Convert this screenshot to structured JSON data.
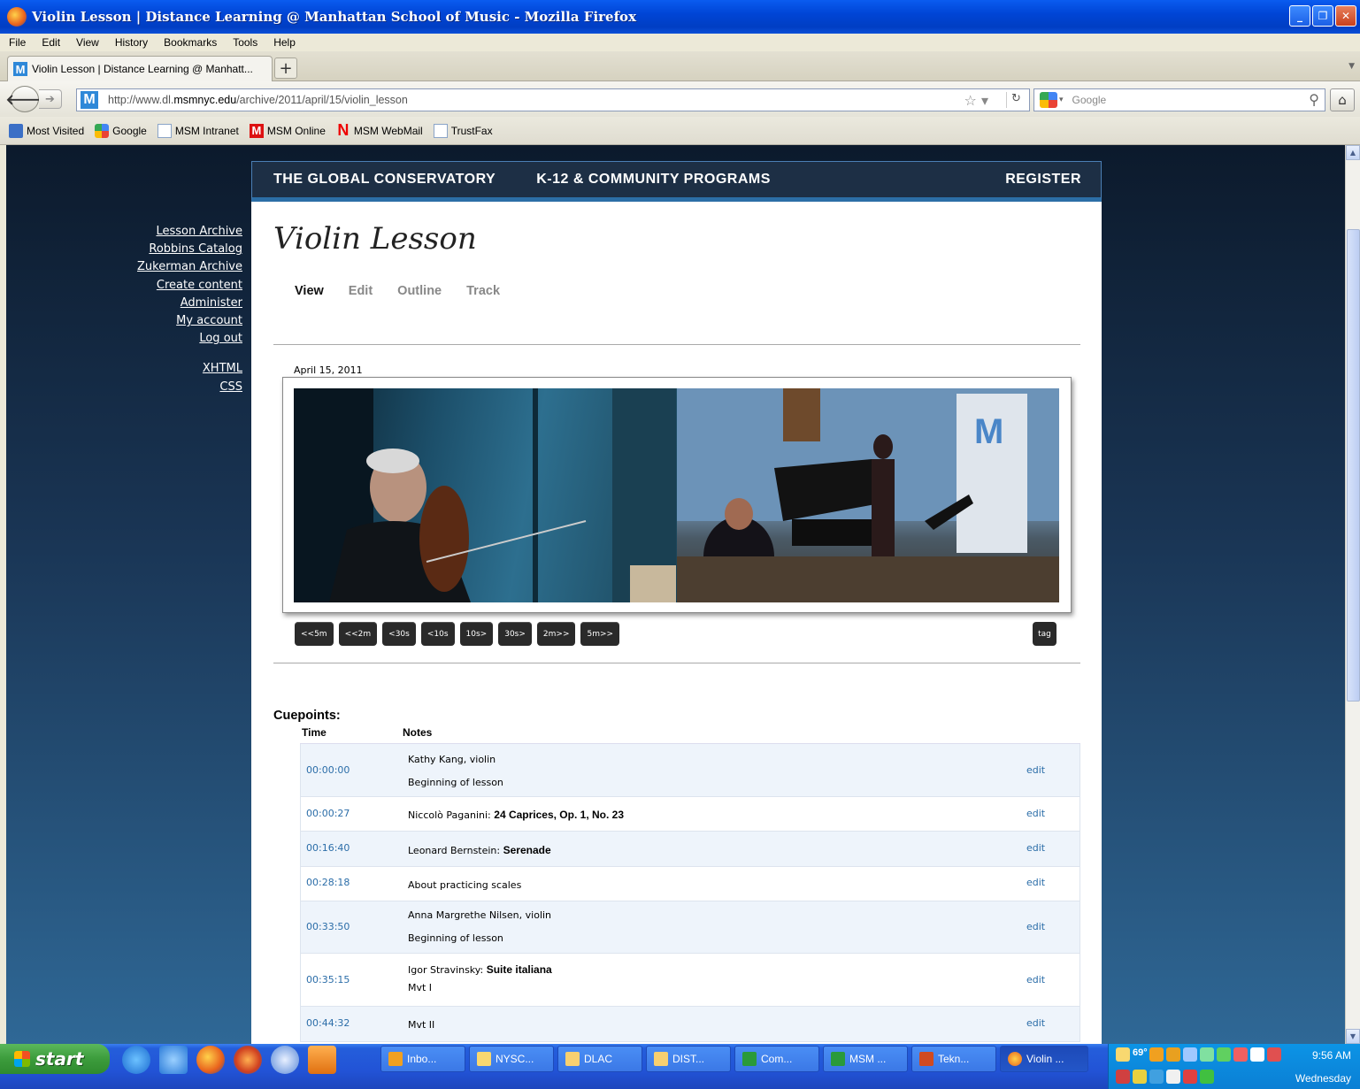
{
  "window": {
    "title": "Violin Lesson | Distance Learning @ Manhattan School of Music - Mozilla Firefox"
  },
  "menu": [
    "File",
    "Edit",
    "View",
    "History",
    "Bookmarks",
    "Tools",
    "Help"
  ],
  "tab": {
    "label": "Violin Lesson | Distance Learning @ Manhatt...",
    "new_tab": "+"
  },
  "nav": {
    "url_domain_prefix": "http://www.dl.",
    "url_domain": "msmnyc.edu",
    "url_path": "/archive/2011/april/15/violin_lesson",
    "search_placeholder": "Google"
  },
  "bookmarks": [
    "Most Visited",
    "Google",
    "MSM Intranet",
    "MSM Online",
    "MSM WebMail",
    "TrustFax"
  ],
  "site": {
    "nav": {
      "global": "THE GLOBAL CONSERVATORY",
      "k12": "K-12 & COMMUNITY PROGRAMS",
      "register": "REGISTER"
    },
    "links": [
      "Lesson Archive",
      "Robbins Catalog",
      "Zukerman Archive",
      "Create content",
      "Administer",
      "My account",
      "Log out"
    ],
    "footer_links": [
      "XHTML",
      "CSS"
    ],
    "page_title": "Violin Lesson",
    "view_tabs": [
      "View",
      "Edit",
      "Outline",
      "Track"
    ],
    "date": "April 15, 2011",
    "controls": [
      "<<5m",
      "<<2m",
      "<30s",
      "<10s",
      "10s>",
      "30s>",
      "2m>>",
      "5m>>"
    ],
    "tag_label": "tag",
    "cuepoints_heading": "Cuepoints:",
    "col_time": "Time",
    "col_notes": "Notes",
    "edit_label": "edit",
    "cuepoints": [
      {
        "time": "00:00:00",
        "line1": "Kathy Kang, violin",
        "line1_bold": "",
        "line2": "Beginning of lesson"
      },
      {
        "time": "00:00:27",
        "line1": "Niccolò Paganini: ",
        "line1_bold": "24 Caprices, Op. 1, No. 23",
        "line2": ""
      },
      {
        "time": "00:16:40",
        "line1": "Leonard Bernstein: ",
        "line1_bold": "Serenade",
        "line2": ""
      },
      {
        "time": "00:28:18",
        "line1": "About practicing scales",
        "line1_bold": "",
        "line2": ""
      },
      {
        "time": "00:33:50",
        "line1": "Anna Margrethe Nilsen, violin",
        "line1_bold": "",
        "line2": "Beginning of lesson"
      },
      {
        "time": "00:35:15",
        "line1": "Igor Stravinsky: ",
        "line1_bold": "Suite italiana",
        "line2": "Mvt I"
      },
      {
        "time": "00:44:32",
        "line1": "Mvt II",
        "line1_bold": "",
        "line2": ""
      }
    ]
  },
  "taskbar": {
    "start": "start",
    "tasks": [
      "Inbo...",
      "NYSC...",
      "DLAC",
      "DIST...",
      "Com...",
      "MSM ...",
      "Tekn...",
      "Violin ..."
    ],
    "temp": "69°",
    "clock": "9:56 AM",
    "day": "Wednesday"
  }
}
